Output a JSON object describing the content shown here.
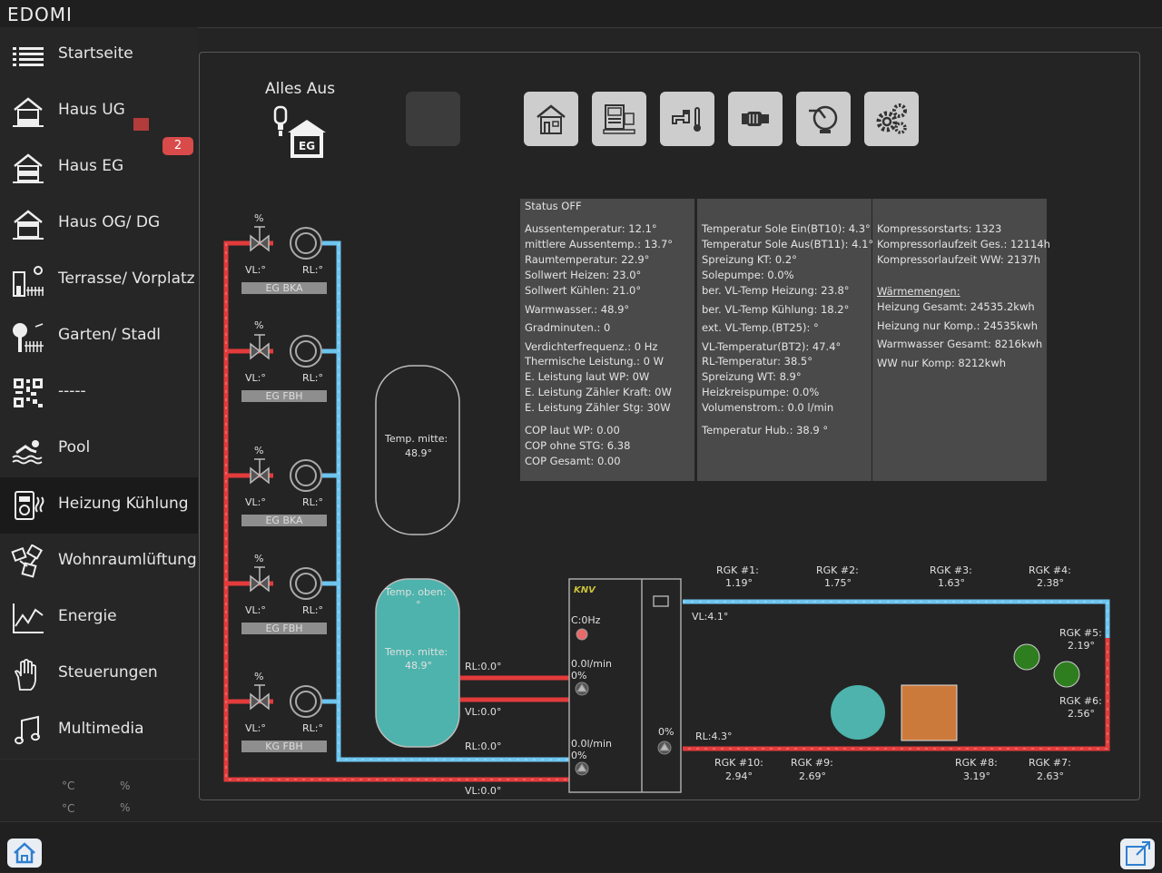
{
  "app": {
    "logo": "EDOMI"
  },
  "nav": [
    {
      "label": "Startseite",
      "icon": "list-icon"
    },
    {
      "label": "Haus UG",
      "icon": "house-ug-icon"
    },
    {
      "label": "Haus EG",
      "icon": "house-eg-icon",
      "badge": "2"
    },
    {
      "label": "Haus OG/ DG",
      "icon": "house-og-icon"
    },
    {
      "label": "Terrasse/ Vorplatz",
      "icon": "terrace-icon"
    },
    {
      "label": "Garten/ Stadl",
      "icon": "garden-icon"
    },
    {
      "label": "-----",
      "icon": "qr-code-icon"
    },
    {
      "label": "Pool",
      "icon": "swimmer-icon"
    },
    {
      "label": "Heizung Kühlung",
      "icon": "heating-icon"
    },
    {
      "label": "Wohnraumlüftung",
      "icon": "ventilation-icon"
    },
    {
      "label": "Energie",
      "icon": "chart-line-icon"
    },
    {
      "label": "Steuerungen",
      "icon": "hand-icon"
    },
    {
      "label": "Multimedia",
      "icon": "music-note-icon"
    }
  ],
  "side_status": {
    "t1": "°C",
    "p1": "%",
    "t2": "°C",
    "p2": "%"
  },
  "panel": {
    "alles_aus": "Alles Aus",
    "eg_tag": "EG",
    "toolbar_icons": [
      "house-icon",
      "heatpump-icon",
      "tap-thermometer-icon",
      "pump-icon",
      "circulation-pump-icon",
      "gears-icon"
    ]
  },
  "status": {
    "col1": [
      "Status OFF",
      "Aussentemperatur: 12.1°",
      "mittlere Aussentemp.: 13.7°",
      "Raumtemperatur: 22.9°",
      "Sollwert Heizen: 23.0°",
      "Sollwert Kühlen: 21.0°",
      "Warmwasser.: 48.9°",
      "Gradminuten.: 0",
      "Verdichterfrequenz.: 0 Hz",
      "Thermische Leistung.: 0 W",
      "E. Leistung laut WP: 0W",
      "E. Leistung Zähler Kraft: 0W",
      "E. Leistung Zähler Stg: 30W",
      "COP laut WP: 0.00",
      "COP ohne STG: 6.38",
      "COP Gesamt: 0.00"
    ],
    "col2": [
      "Temperatur Sole Ein(BT10): 4.3°",
      "Temperatur Sole Aus(BT11): 4.1°",
      "Spreizung KT: 0.2°",
      "Solepumpe: 0.0%",
      "ber. VL-Temp Heizung: 23.8°",
      "ber. VL-Temp Kühlung: 18.2°",
      "ext. VL-Temp.(BT25): °",
      "VL-Temperatur(BT2): 47.4°",
      "RL-Temperatur: 38.5°",
      "Spreizung WT: 8.9°",
      "Heizkreispumpe: 0.0%",
      "Volumenstrom.: 0.0 l/min",
      "Temperatur Hub.: 38.9 °"
    ],
    "col3": [
      "Kompressorstarts: 1323",
      "Kompressorlaufzeit Ges.: 12114h",
      "Kompressorlaufzeit WW: 2137h",
      "Wärmemengen:",
      "Heizung Gesamt: 24535.2kwh",
      "Heizung nur Komp.: 24535kwh",
      "Warmwasser Gesamt: 8216kwh",
      "WW nur Komp: 8212kwh"
    ]
  },
  "circuits": [
    {
      "percent": "%",
      "vl": "VL:°",
      "rl": "RL:°",
      "name": "EG BKA"
    },
    {
      "percent": "%",
      "vl": "VL:°",
      "rl": "RL:°",
      "name": "EG FBH"
    },
    {
      "percent": "%",
      "vl": "VL:°",
      "rl": "RL:°",
      "name": "EG BKA"
    },
    {
      "percent": "%",
      "vl": "VL:°",
      "rl": "RL:°",
      "name": "EG FBH"
    },
    {
      "percent": "%",
      "vl": "VL:°",
      "rl": "RL:°",
      "name": "KG FBH"
    }
  ],
  "tanks": {
    "buffer_label": "Temp. mitte:",
    "buffer_value": "48.9°",
    "dhw_top_label": "Temp. oben:",
    "dhw_top_value": "°",
    "dhw_mid_label": "Temp. mitte:",
    "dhw_mid_value": "48.9°"
  },
  "pipes": {
    "rl1": "RL:0.0°",
    "vl1": "VL:0.0°",
    "rl2": "RL:0.0°",
    "vl_bottom": "VL:0.0°"
  },
  "heatpump": {
    "brand": "KNV",
    "compressor": "C:0Hz",
    "flow1": "0.0l/min",
    "pct1": "0%",
    "flow2": "0.0l/min",
    "pct2": "0%",
    "brine_pct": "0%"
  },
  "ground": {
    "vl": "VL:4.1°",
    "rl": "RL:4.3°",
    "rgk": [
      {
        "name": "RGK #1:",
        "value": "1.19°"
      },
      {
        "name": "RGK #2:",
        "value": "1.75°"
      },
      {
        "name": "RGK #3:",
        "value": "1.63°"
      },
      {
        "name": "RGK #4:",
        "value": "2.38°"
      },
      {
        "name": "RGK #5:",
        "value": "2.19°"
      },
      {
        "name": "RGK #6:",
        "value": "2.56°"
      },
      {
        "name": "RGK #7:",
        "value": "2.63°"
      },
      {
        "name": "RGK #8:",
        "value": "3.19°"
      },
      {
        "name": "RGK #9:",
        "value": "2.69°"
      },
      {
        "name": "RGK #10:",
        "value": "2.94°"
      }
    ]
  },
  "colors": {
    "hot": "#e33b3b",
    "cold": "#6cc4ef",
    "teal": "#4db3ac",
    "orange": "#cc7a3c",
    "green": "#2e7d1f"
  }
}
